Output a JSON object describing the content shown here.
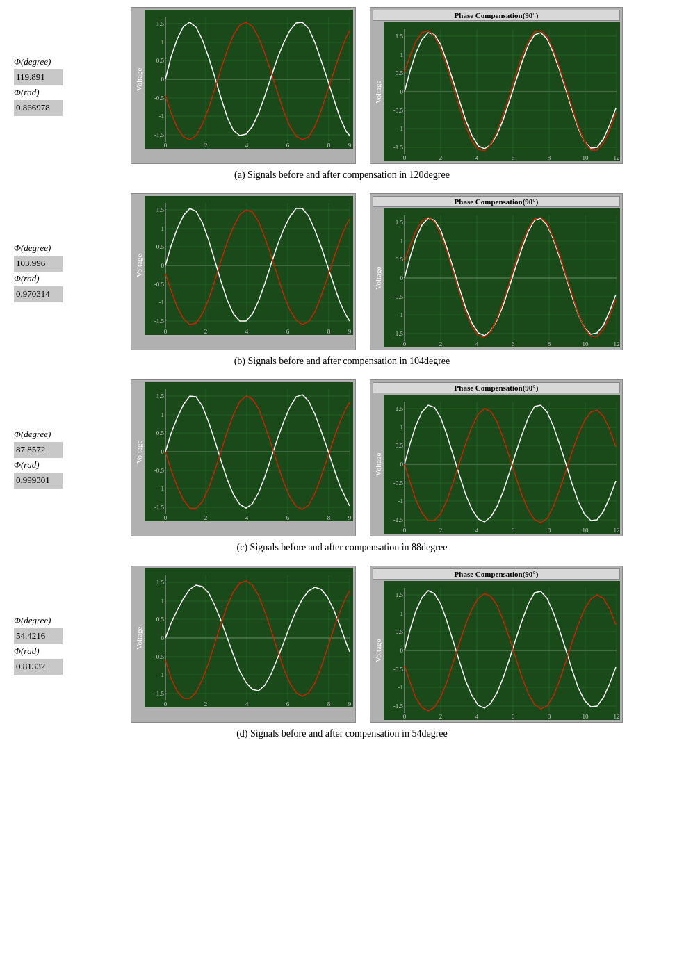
{
  "sections": [
    {
      "id": "a",
      "phi_degree_label": "Φ(degree)",
      "phi_degree_value": "119.891",
      "phi_rad_label": "Φ(rad)",
      "phi_rad_value": "0.866978",
      "caption": "(a)  Signals  before  and  after  compensation  in  120degree",
      "left_chart": {
        "title": null,
        "x_max": 9,
        "y_max": 1.5,
        "y_min": -1.5
      },
      "right_chart": {
        "title": "Phase Compensation(90°)",
        "x_max": 12,
        "y_max": 1.5,
        "y_min": -1.5
      }
    },
    {
      "id": "b",
      "phi_degree_label": "Φ(degree)",
      "phi_degree_value": "103.996",
      "phi_rad_label": "Φ(rad)",
      "phi_rad_value": "0.970314",
      "caption": "(b)  Signals  before  and  after  compensation  in  104degree",
      "left_chart": {
        "title": null,
        "x_max": 9,
        "y_max": 1.5,
        "y_min": -1.5
      },
      "right_chart": {
        "title": "Phase Compensation(90°)",
        "x_max": 12,
        "y_max": 1.5,
        "y_min": -1.5
      }
    },
    {
      "id": "c",
      "phi_degree_label": "Φ(degree)",
      "phi_degree_value": "87.8572",
      "phi_rad_label": "Φ(rad)",
      "phi_rad_value": "0.999301",
      "caption": "(c)  Signals  before  and  after  compensation  in  88degree",
      "left_chart": {
        "title": null,
        "x_max": 9,
        "y_max": 1.5,
        "y_min": -1.5
      },
      "right_chart": {
        "title": "Phase Compensation(90°)",
        "x_max": 12,
        "y_max": 1.5,
        "y_min": -1.5
      }
    },
    {
      "id": "d",
      "phi_degree_label": "Φ(degree)",
      "phi_degree_value": "54.4216",
      "phi_rad_label": "Φ(rad)",
      "phi_rad_value": "0.81332",
      "caption": "(d)  Signals  before  and  after  compensation  in  54degree",
      "left_chart": {
        "title": null,
        "x_max": 9,
        "y_max": 1.5,
        "y_min": -1.5
      },
      "right_chart": {
        "title": "Phase Compensation(90°)",
        "x_max": 12,
        "y_max": 1.5,
        "y_min": -1.5
      }
    }
  ]
}
